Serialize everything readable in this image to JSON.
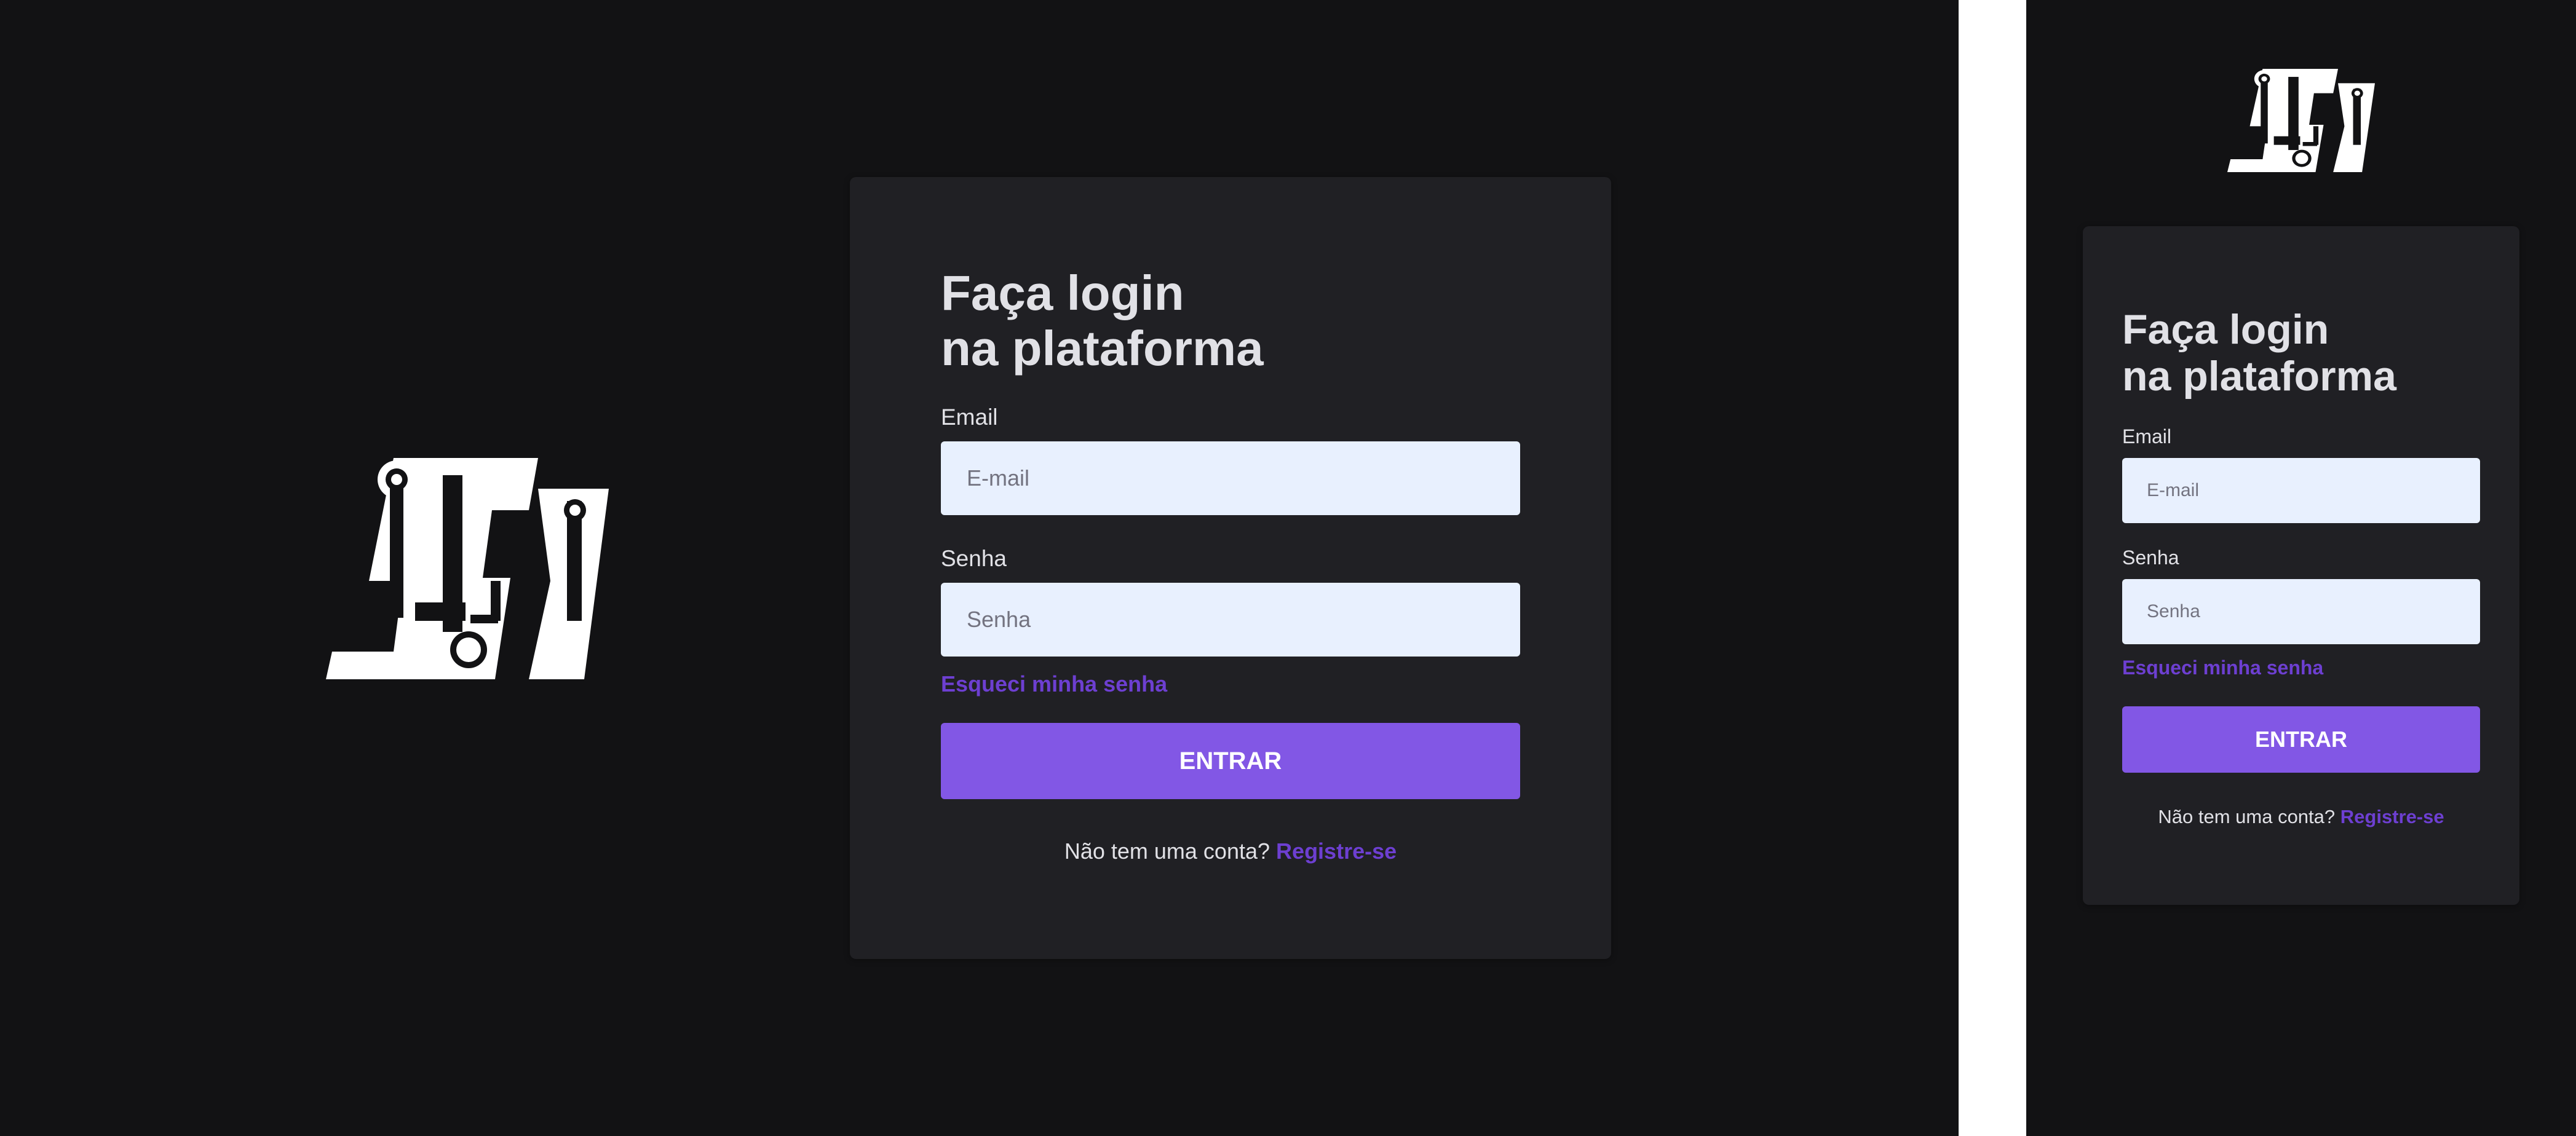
{
  "logo": {
    "name": "si-logo",
    "color": "#ffffff"
  },
  "login": {
    "title_line1": "Faça login",
    "title_line2": "na plataforma",
    "email_label": "Email",
    "email_placeholder": "E-mail",
    "password_label": "Senha",
    "password_placeholder": "Senha",
    "forgot_link": "Esqueci minha senha",
    "submit_label": "ENTRAR",
    "no_account_text": "Não tem uma conta?",
    "register_link": "Registre-se"
  },
  "colors": {
    "background": "#121214",
    "card": "#202024",
    "accent": "#8257e5",
    "link": "#6d3fd1",
    "input_bg": "#e8f0fe",
    "text": "#e1e1e6"
  }
}
